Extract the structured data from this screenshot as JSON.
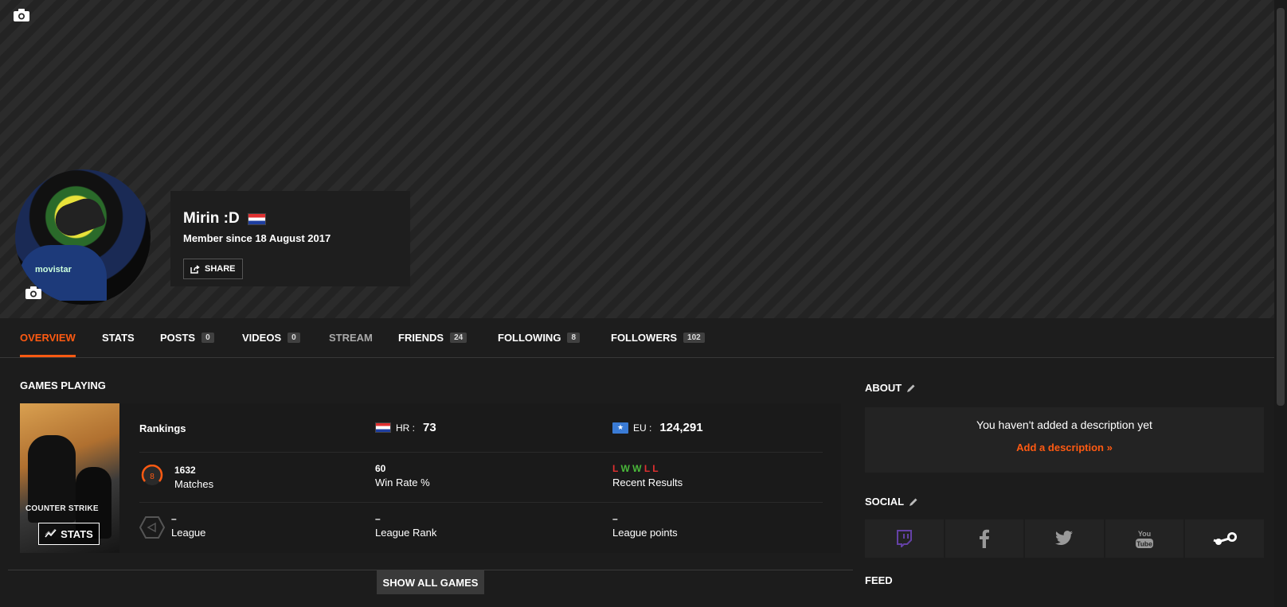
{
  "profile": {
    "username": "Mirin :D",
    "member_since": "Member since 18 August 2017",
    "share_label": "SHARE"
  },
  "tabs": [
    {
      "label": "OVERVIEW",
      "count": null
    },
    {
      "label": "STATS",
      "count": null
    },
    {
      "label": "POSTS",
      "count": "0"
    },
    {
      "label": "VIDEOS",
      "count": "0"
    },
    {
      "label": "STREAM",
      "count": null
    },
    {
      "label": "FRIENDS",
      "count": "24"
    },
    {
      "label": "FOLLOWING",
      "count": "8"
    },
    {
      "label": "FOLLOWERS",
      "count": "102"
    }
  ],
  "games": {
    "title": "GAMES PLAYING",
    "cover_logo": "COUNTER STRIKE",
    "stats_label": "STATS",
    "rankings_label": "Rankings",
    "hr_label": "HR :",
    "hr_value": "73",
    "eu_label": "EU :",
    "eu_value": "124,291",
    "level": "8",
    "matches_value": "1632",
    "matches_label": "Matches",
    "winrate_value": "60",
    "winrate_label": "Win Rate %",
    "recent_results": [
      "L",
      "W",
      "W",
      "L",
      "L"
    ],
    "recent_label": "Recent Results",
    "league_value": "–",
    "league_label": "League",
    "league_rank_value": "–",
    "league_rank_label": "League Rank",
    "league_points_value": "–",
    "league_points_label": "League points",
    "show_all_label": "SHOW ALL GAMES"
  },
  "about": {
    "title": "ABOUT",
    "message": "You haven't added a description yet",
    "add_label": "Add a description »"
  },
  "social": {
    "title": "SOCIAL",
    "icons": [
      "twitch-icon",
      "facebook-icon",
      "twitter-icon",
      "youtube-icon",
      "steam-icon"
    ]
  },
  "feed": {
    "title": "FEED"
  },
  "colors": {
    "accent": "#ff5a12",
    "win": "#4ab83a",
    "loss": "#e03030",
    "twitch": "#6441a5"
  }
}
